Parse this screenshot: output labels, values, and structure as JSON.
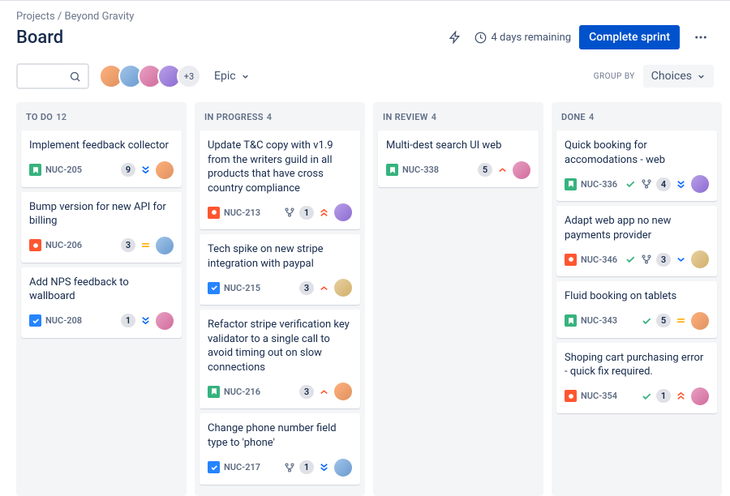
{
  "breadcrumb": "Projects / Beyond Gravity",
  "page_title": "Board",
  "time_remaining": "4 days remaining",
  "complete_sprint": "Complete sprint",
  "avatar_more": "+3",
  "epic_label": "Epic",
  "group_by_label": "GROUP BY",
  "choices_label": "Choices",
  "columns": [
    {
      "name": "TO DO",
      "count": "12"
    },
    {
      "name": "IN PROGRESS",
      "count": "4"
    },
    {
      "name": "IN REVIEW",
      "count": "4"
    },
    {
      "name": "DONE",
      "count": "4"
    }
  ],
  "cards": {
    "todo": [
      {
        "title": "Implement feedback collector",
        "type": "story",
        "key": "NUC-205",
        "points": "9",
        "priority": "lowest",
        "avatar": "av1"
      },
      {
        "title": "Bump version for new API for billing",
        "type": "bug",
        "key": "NUC-206",
        "points": "3",
        "priority": "medium",
        "avatar": "av2"
      },
      {
        "title": "Add NPS feedback to wallboard",
        "type": "task",
        "key": "NUC-208",
        "points": "1",
        "priority": "lowest",
        "avatar": "av3"
      }
    ],
    "progress": [
      {
        "title": "Update T&C copy with v1.9 from the writers guild in all products that have cross country compliance",
        "type": "bug",
        "key": "NUC-213",
        "branch": true,
        "points": "1",
        "priority": "highest",
        "avatar": "av4"
      },
      {
        "title": "Tech spike on new stripe integration with paypal",
        "type": "task",
        "key": "NUC-215",
        "points": "3",
        "priority": "high",
        "avatar": "av5"
      },
      {
        "title": "Refactor stripe verification key validator to a single call to avoid timing out on slow connections",
        "type": "story",
        "key": "NUC-216",
        "points": "3",
        "priority": "high",
        "avatar": "av1"
      },
      {
        "title": "Change phone number field type to 'phone'",
        "type": "task",
        "key": "NUC-217",
        "branch": true,
        "points": "1",
        "priority": "lowest",
        "avatar": "av2"
      }
    ],
    "review": [
      {
        "title": "Multi-dest search UI web",
        "type": "story",
        "key": "NUC-338",
        "points": "5",
        "priority": "high",
        "avatar": "av3"
      }
    ],
    "done": [
      {
        "title": "Quick booking for accomodations - web",
        "type": "story",
        "key": "NUC-336",
        "check": true,
        "branch": true,
        "points": "4",
        "priority": "lowest",
        "avatar": "av4"
      },
      {
        "title": "Adapt web app no new payments provider",
        "type": "bug",
        "key": "NUC-346",
        "check": true,
        "branch": true,
        "points": "3",
        "priority": "low",
        "avatar": "av5"
      },
      {
        "title": "Fluid booking on tablets",
        "type": "story",
        "key": "NUC-343",
        "check": true,
        "points": "5",
        "priority": "medium",
        "avatar": "av1"
      },
      {
        "title": "Shoping cart purchasing error - quick fix required.",
        "type": "bug",
        "key": "NUC-354",
        "check": true,
        "points": "1",
        "priority": "highest",
        "avatar": "av3"
      }
    ]
  }
}
